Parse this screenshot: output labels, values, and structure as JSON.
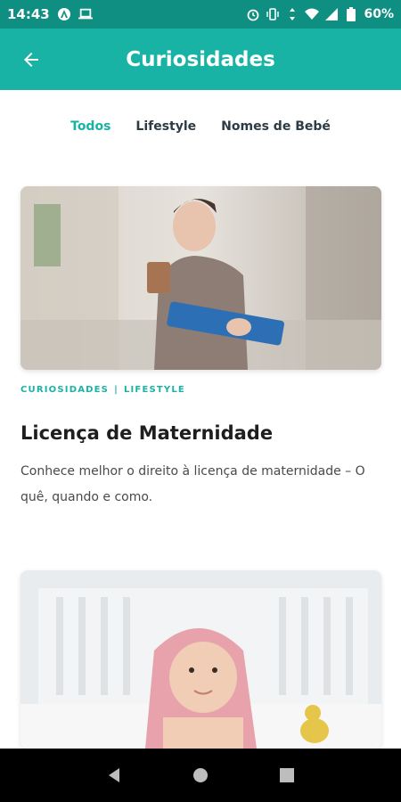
{
  "status_bar": {
    "time": "14:43",
    "battery": "60%"
  },
  "header": {
    "title": "Curiosidades",
    "back_icon": "arrow-back-icon"
  },
  "tabs": [
    {
      "label": "Todos",
      "active": true
    },
    {
      "label": "Lifestyle",
      "active": false
    },
    {
      "label": "Nomes de Bebé",
      "active": false
    }
  ],
  "articles": [
    {
      "categories": [
        "CURIOSIDADES",
        "LIFESTYLE"
      ],
      "title": "Licença de Maternidade",
      "description": "Conhece melhor o direito à licença de maternidade – O quê, quando e como."
    }
  ],
  "colors": {
    "accent": "#19b3a6",
    "status_bar": "#0f8f82",
    "nav_bar": "#000000"
  }
}
